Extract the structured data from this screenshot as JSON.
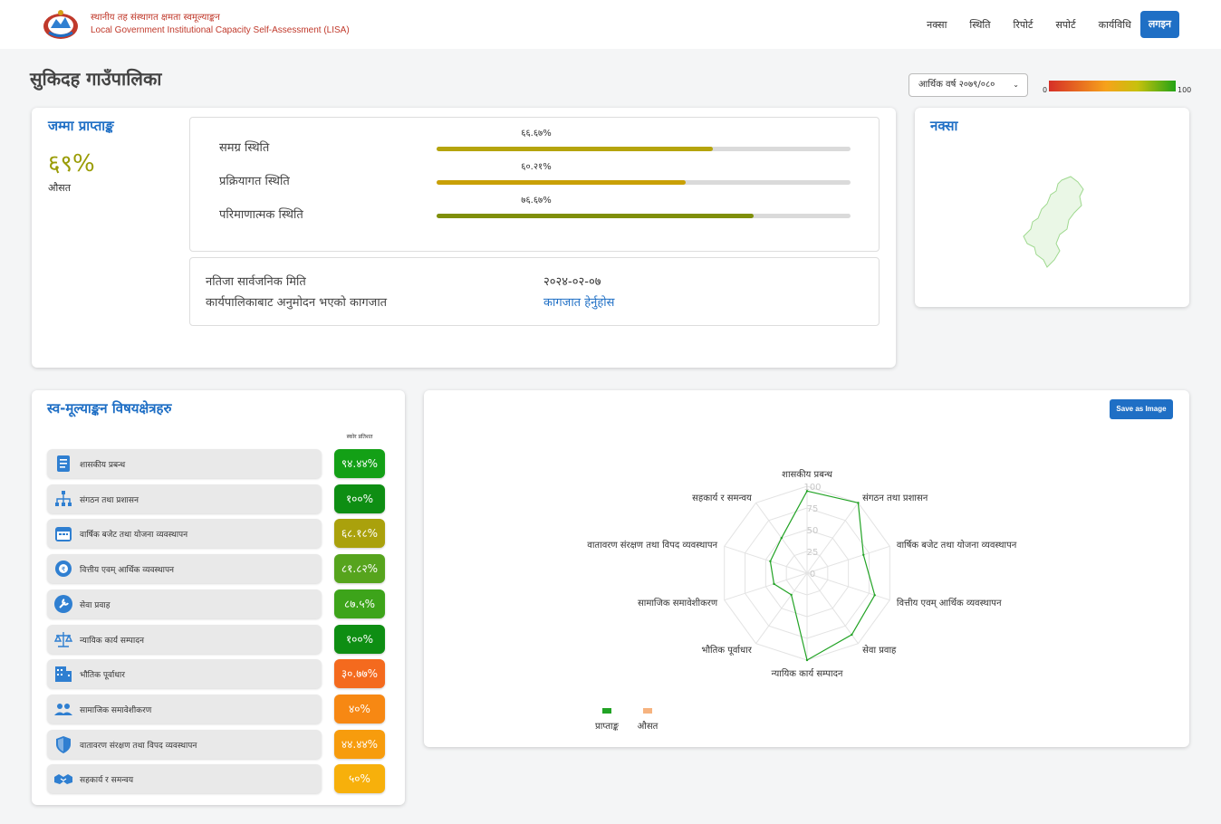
{
  "header": {
    "org_np": "स्थानीय तह संस्थागत क्षमता स्वमूल्याङ्कन",
    "org_en": "Local Government Institutional Capacity Self-Assessment (LISA)",
    "nav": [
      "नक्सा",
      "स्थिति",
      "रिपोर्ट",
      "सपोर्ट",
      "कार्यविधि"
    ],
    "login": "लगइन"
  },
  "page_title": "सुकिदह गाउँपालिका",
  "year_select": {
    "value": "आर्थिक वर्ष २०७९/०८०",
    "caret": "⌄"
  },
  "legend": {
    "min": "0",
    "max": "100",
    "colors": [
      "#d62f27",
      "#f6a21b",
      "#c7c10d",
      "#23a316"
    ]
  },
  "total": {
    "title": "जम्मा प्राप्ताङ्क",
    "score": "६९%",
    "avg_label": "औसत",
    "statuses": [
      {
        "label": "समग्र स्थिति",
        "pct": "६६.६७%",
        "value": 0.6667,
        "color": "#b5a40c"
      },
      {
        "label": "प्रक्रियागत स्थिति",
        "pct": "६०.२१%",
        "value": 0.6021,
        "color": "#c9a006"
      },
      {
        "label": "परिमाणात्मक स्थिति",
        "pct": "७६.६७%",
        "value": 0.7667,
        "color": "#7f8f0a"
      }
    ],
    "info": {
      "date_label": "नतिजा सार्वजनिक मिति",
      "date_value": "२०२४-०२-०७",
      "doc_label": "कार्यपालिकाबाट अनुमोदन भएको कागजात",
      "doc_link": "कागजात हेर्नुहोस"
    }
  },
  "map": {
    "title": "नक्सा"
  },
  "areas": {
    "title": "स्व-मूल्याङ्कन विषयक्षेत्रहरु",
    "score_header": "स्कोर प्रतिशत",
    "items": [
      {
        "label": "शासकीय प्रबन्ध",
        "score": "९४.४४%",
        "color": "#13a016",
        "icon": "document-list-icon"
      },
      {
        "label": "संगठन तथा प्रशासन",
        "score": "१००%",
        "color": "#0e8e13",
        "icon": "org-chart-icon"
      },
      {
        "label": "वार्षिक बजेट तथा योजना व्यवस्थापन",
        "score": "६८.१८%",
        "color": "#aaa10c",
        "icon": "calendar-icon"
      },
      {
        "label": "वित्तीय एवम् आर्थिक व्यवस्थापन",
        "score": "८१.८२%",
        "color": "#56a41d",
        "icon": "finance-gear-icon"
      },
      {
        "label": "सेवा प्रवाह",
        "score": "८७.५%",
        "color": "#3da41a",
        "icon": "wrench-icon"
      },
      {
        "label": "न्यायिक कार्य सम्पादन",
        "score": "१००%",
        "color": "#0e8e13",
        "icon": "scales-icon"
      },
      {
        "label": "भौतिक पूर्वाधार",
        "score": "३०.७७%",
        "color": "#f46a1e",
        "icon": "building-icon"
      },
      {
        "label": "सामाजिक समावेशीकरण",
        "score": "४०%",
        "color": "#f78813",
        "icon": "people-icon"
      },
      {
        "label": "वातावरण संरक्षण तथा विपद व्यवस्थापन",
        "score": "४४.४४%",
        "color": "#f79c0d",
        "icon": "shield-icon"
      },
      {
        "label": "सहकार्य र समन्वय",
        "score": "५०%",
        "color": "#f7b00b",
        "icon": "handshake-icon"
      }
    ]
  },
  "radar": {
    "save_label": "Save as Image",
    "legend": [
      {
        "name": "प्राप्ताङ्क",
        "color": "#22a325"
      },
      {
        "name": "औसत",
        "color": "#f6b37f"
      }
    ]
  },
  "chart_data": {
    "type": "radar",
    "categories": [
      "शासकीय प्रबन्ध",
      "संगठन तथा प्रशासन",
      "वार्षिक बजेट तथा योजना व्यवस्थापन",
      "वित्तीय एवम् आर्थिक व्यवस्थापन",
      "सेवा प्रवाह",
      "न्यायिक कार्य सम्पादन",
      "भौतिक पूर्वाधार",
      "सामाजिक समावेशीकरण",
      "वातावरण संरक्षण तथा विपद व्यवस्थापन",
      "सहकार्य र समन्वय"
    ],
    "series": [
      {
        "name": "प्राप्ताङ्क",
        "values": [
          94.44,
          100,
          68.18,
          81.82,
          87.5,
          100,
          30.77,
          40,
          44.44,
          50
        ],
        "color": "#22a325"
      }
    ],
    "rlim": [
      0,
      100
    ],
    "ticks": [
      0,
      25,
      50,
      75,
      100
    ],
    "legend_position": "bottom-left"
  }
}
